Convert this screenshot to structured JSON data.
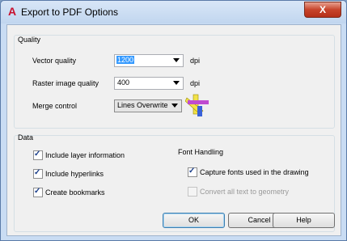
{
  "window": {
    "title": "Export to PDF Options",
    "close_glyph": "X"
  },
  "quality": {
    "group_label": "Quality",
    "vector_label": "Vector quality",
    "vector_value": "1200",
    "vector_unit": "dpi",
    "raster_label": "Raster image quality",
    "raster_value": "400",
    "raster_unit": "dpi",
    "merge_label": "Merge control",
    "merge_value": "Lines Overwrite"
  },
  "data": {
    "group_label": "Data",
    "layer_info": {
      "label": "Include layer information",
      "checked": true
    },
    "hyperlinks": {
      "label": "Include hyperlinks",
      "checked": true
    },
    "bookmarks": {
      "label": "Create bookmarks",
      "checked": true
    },
    "font_heading": "Font Handling",
    "capture_fonts": {
      "label": "Capture fonts used in the drawing",
      "checked": true
    },
    "convert_text": {
      "label": "Convert all text to geometry",
      "checked": false,
      "disabled": true
    }
  },
  "buttons": {
    "ok": "OK",
    "cancel": "Cancel",
    "help": "Help"
  },
  "icons": {
    "app": "autocad-a-icon",
    "merge_preview": "lines-overwrite-preview-icon"
  },
  "colors": {
    "accent": "#c8102e",
    "selection": "#3399ff"
  }
}
